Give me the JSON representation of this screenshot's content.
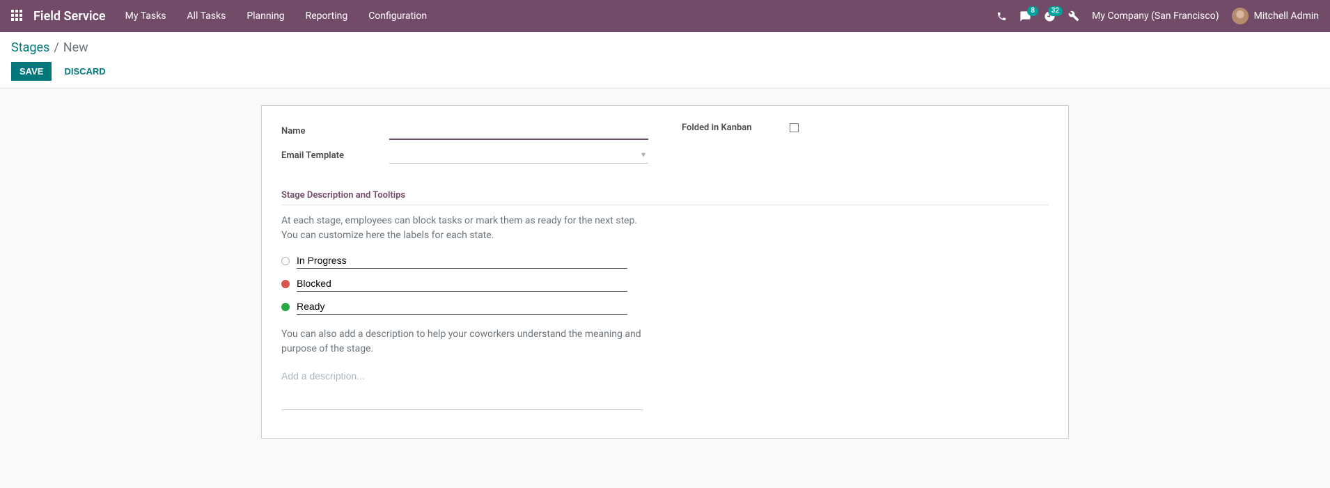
{
  "navbar": {
    "app_title": "Field Service",
    "menu": [
      {
        "label": "My Tasks"
      },
      {
        "label": "All Tasks"
      },
      {
        "label": "Planning"
      },
      {
        "label": "Reporting"
      },
      {
        "label": "Configuration"
      }
    ],
    "messages_badge": "8",
    "activities_badge": "32",
    "company": "My Company (San Francisco)",
    "user": "Mitchell Admin"
  },
  "breadcrumb": {
    "parent": "Stages",
    "current": "New"
  },
  "buttons": {
    "save": "SAVE",
    "discard": "DISCARD"
  },
  "form": {
    "name_label": "Name",
    "name_value": "",
    "email_template_label": "Email Template",
    "email_template_value": "",
    "folded_label": "Folded in Kanban",
    "section_title": "Stage Description and Tooltips",
    "info1": "At each stage, employees can block tasks or mark them as ready for the next step. You can customize here the labels for each state.",
    "statuses": {
      "in_progress": "In Progress",
      "blocked": "Blocked",
      "ready": "Ready"
    },
    "info2": "You can also add a description to help your coworkers understand the meaning and purpose of the stage.",
    "description_placeholder": "Add a description..."
  }
}
